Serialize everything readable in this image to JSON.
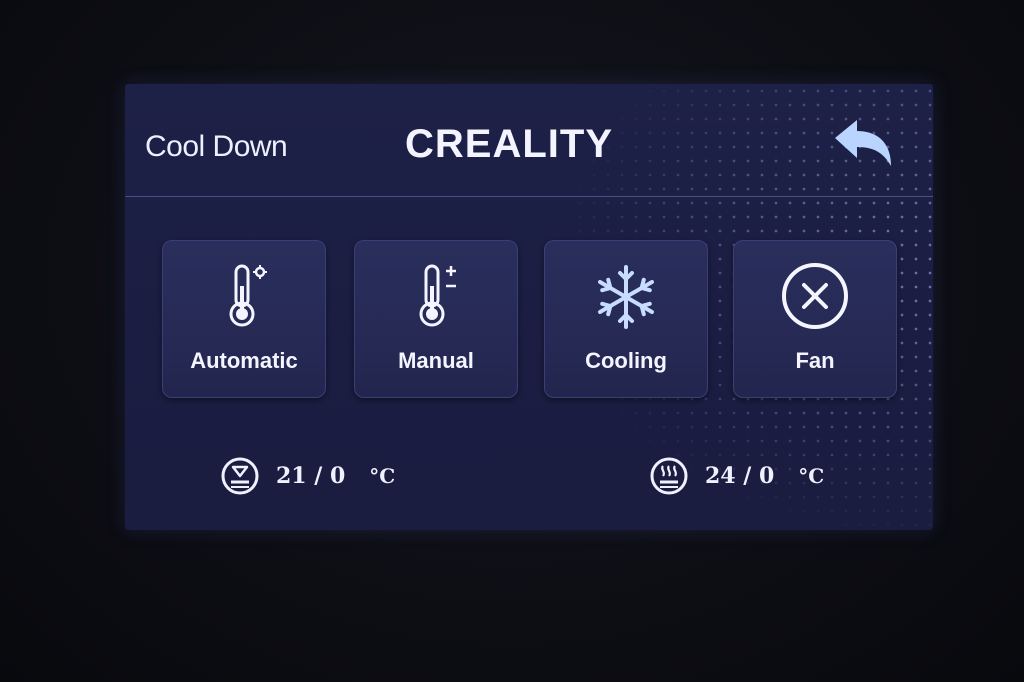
{
  "header": {
    "title": "Cool Down",
    "logo": "CREALITY"
  },
  "tiles": [
    {
      "label": "Automatic",
      "icon": "thermometer-auto-icon"
    },
    {
      "label": "Manual",
      "icon": "thermometer-manual-icon"
    },
    {
      "label": "Cooling",
      "icon": "snowflake-icon"
    },
    {
      "label": "Fan",
      "icon": "fan-off-icon"
    }
  ],
  "status": {
    "bed": {
      "icon": "bed-temperature-icon",
      "value": "21 / 0",
      "unit": "°C"
    },
    "nozzle": {
      "icon": "nozzle-temperature-icon",
      "value": "24 / 0",
      "unit": "°C"
    }
  },
  "colors": {
    "screen_bg": "#1e2147",
    "tile_bg": "#2a2e5c",
    "text": "#f3f4ff",
    "accent": "#b8d4ff"
  }
}
